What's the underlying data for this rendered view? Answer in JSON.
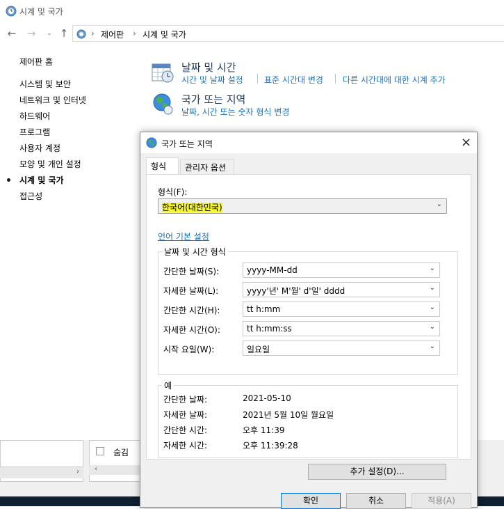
{
  "window": {
    "title": "시계 및 국가",
    "breadcrumb": [
      "제어판",
      "시계 및 국가"
    ]
  },
  "left_nav": {
    "home": "제어판 홈",
    "items": [
      "시스템 및 보안",
      "네트워크 및 인터넷",
      "하드웨어",
      "프로그램",
      "사용자 계정",
      "모양 및 개인 설정",
      "시계 및 국가",
      "접근성"
    ],
    "current": "시계 및 국가"
  },
  "categories": {
    "datetime": {
      "title": "날짜 및 시간",
      "links": [
        "시간 및 날짜 설정",
        "표준 시간대 변경",
        "다른 시간대에 대한 시계 추가"
      ]
    },
    "region": {
      "title": "국가 또는 지역",
      "links": [
        "날짜, 시간 또는 숫자 형식 변경"
      ]
    }
  },
  "background": {
    "hide_label": "숨김"
  },
  "dialog": {
    "title": "국가 또는 지역",
    "tabs": [
      "형식",
      "관리자 옵션"
    ],
    "format_label": "형식(F):",
    "format_value": "한국어(대한민국)",
    "lang_link": "언어 기본 설정",
    "datetime_group": "날짜 및 시간 형식",
    "fields": [
      {
        "label": "간단한 날짜(S):",
        "value": "yyyy-MM-dd"
      },
      {
        "label": "자세한 날짜(L):",
        "value": "yyyy'년' M'월' d'일' dddd"
      },
      {
        "label": "간단한 시간(H):",
        "value": "tt h:mm"
      },
      {
        "label": "자세한 시간(O):",
        "value": "tt h:mm:ss"
      },
      {
        "label": "시작 요일(W):",
        "value": "일요일"
      }
    ],
    "example_group": "예",
    "examples": [
      {
        "label": "간단한 날짜:",
        "value": "2021-05-10"
      },
      {
        "label": "자세한 날짜:",
        "value": "2021년 5월 10일 월요일"
      },
      {
        "label": "간단한 시간:",
        "value": "오후 11:39"
      },
      {
        "label": "자세한 시간:",
        "value": "오후 11:39:28"
      }
    ],
    "more_settings": "추가 설정(D)...",
    "ok": "확인",
    "cancel": "취소",
    "apply": "적용(A)"
  },
  "colors": {
    "link": "#1a6fbf",
    "category_title": "#1e395b",
    "highlight": "#f5f530",
    "primary_border": "#0078d7"
  }
}
